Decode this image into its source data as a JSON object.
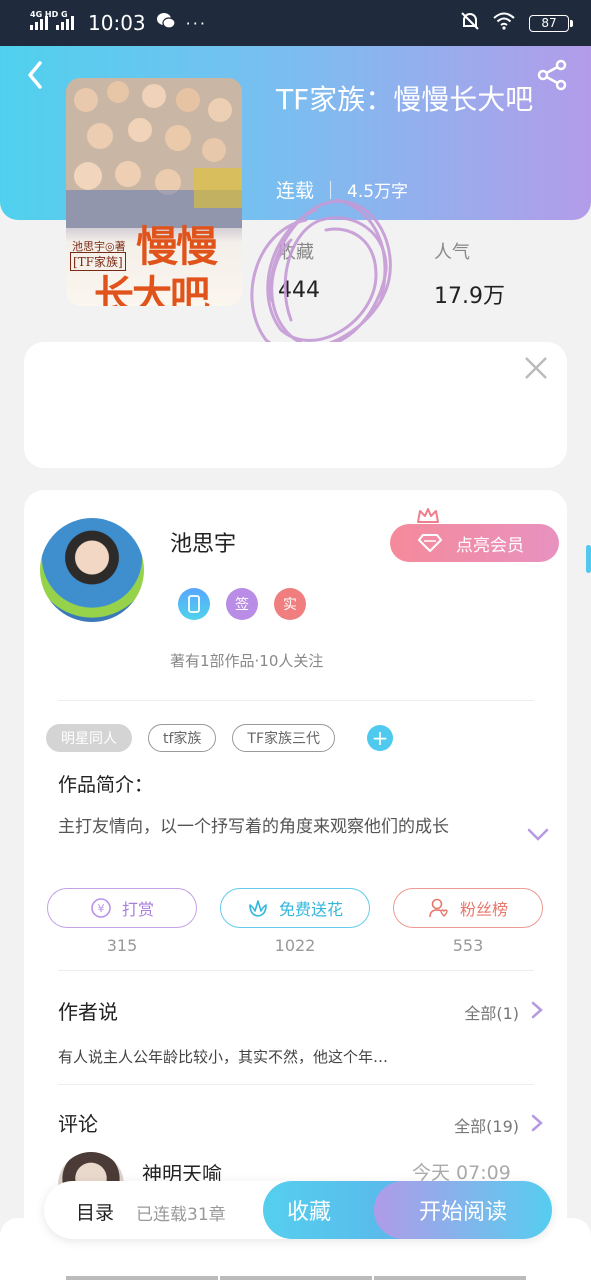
{
  "status_bar": {
    "network": "4G HD G",
    "time": "10:03",
    "more": "···",
    "battery": "87"
  },
  "book": {
    "title": "TF家族：慢慢长大吧",
    "status": "连载",
    "word_count": "4.5万字",
    "cover": {
      "author_line": "池思宇◎著",
      "bracket": "[TF家族]",
      "title_line1": "慢慢",
      "title_line2": "长大吧"
    }
  },
  "stats": {
    "collect_label": "收藏",
    "collect_value": "444",
    "popularity_label": "人气",
    "popularity_value": "17.9万"
  },
  "author": {
    "name": "池思宇",
    "vip_button": "点亮会员",
    "badges": [
      "签",
      "实"
    ],
    "summary": "著有1部作品·10人关注"
  },
  "tags": [
    "明星同人",
    "tf家族",
    "TF家族三代"
  ],
  "intro": {
    "title": "作品简介：",
    "text": "主打友情向，以一个抒写着的角度来观察他们的成长"
  },
  "actions": [
    {
      "label": "打赏",
      "count": "315"
    },
    {
      "label": "免费送花",
      "count": "1022"
    },
    {
      "label": "粉丝榜",
      "count": "553"
    }
  ],
  "author_says": {
    "title": "作者说",
    "all": "全部(1)",
    "text": "有人说主人公年龄比较小，其实不然，他这个年…"
  },
  "comments": {
    "title": "评论",
    "all": "全部(19)",
    "first": {
      "name": "神明天喻",
      "time": "今天 07:09"
    }
  },
  "bottom_bar": {
    "toc": "目录",
    "chapters": "已连载31章",
    "collect": "收藏",
    "read": "开始阅读"
  },
  "colors": {
    "header_start": "#4fd1ee",
    "header_end": "#b39ce9",
    "accent_blue": "#4fc9ee",
    "vip_pink": "#f58a9a"
  }
}
